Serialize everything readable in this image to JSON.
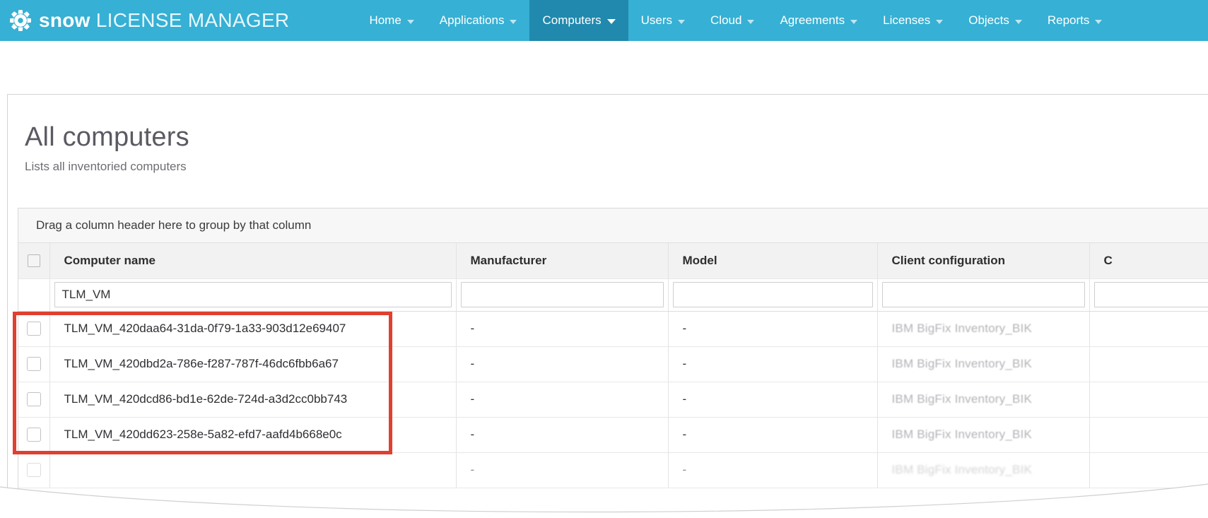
{
  "app": {
    "brand_primary": "snow",
    "brand_secondary": "LICENSE MANAGER",
    "brand_color": "#36b0d4",
    "brand_active_color": "#2089ad",
    "logo_icon": "gear-icon"
  },
  "nav": {
    "items": [
      {
        "label": "Home",
        "active": false,
        "has_caret": true
      },
      {
        "label": "Applications",
        "active": false,
        "has_caret": true
      },
      {
        "label": "Computers",
        "active": true,
        "has_caret": true
      },
      {
        "label": "Users",
        "active": false,
        "has_caret": true
      },
      {
        "label": "Cloud",
        "active": false,
        "has_caret": true
      },
      {
        "label": "Agreements",
        "active": false,
        "has_caret": true
      },
      {
        "label": "Licenses",
        "active": false,
        "has_caret": true
      },
      {
        "label": "Objects",
        "active": false,
        "has_caret": true
      },
      {
        "label": "Reports",
        "active": false,
        "has_caret": true
      }
    ]
  },
  "page": {
    "title": "All computers",
    "subtitle": "Lists all inventoried computers"
  },
  "grid": {
    "group_bar_text": "Drag a column header here to group by that column",
    "columns": [
      {
        "key": "checkbox",
        "label": ""
      },
      {
        "key": "name",
        "label": "Computer name"
      },
      {
        "key": "manufacturer",
        "label": "Manufacturer"
      },
      {
        "key": "model",
        "label": "Model"
      },
      {
        "key": "client_configuration",
        "label": "Client configuration"
      },
      {
        "key": "extra",
        "label": "C"
      }
    ],
    "filters": {
      "name": "TLM_VM",
      "name_placeholder": "",
      "manufacturer": "",
      "model": "",
      "client_configuration": "",
      "extra": ""
    },
    "rows": [
      {
        "name": "TLM_VM_420daa64-31da-0f79-1a33-903d12e69407",
        "manufacturer": "-",
        "model": "-",
        "client_configuration": "IBM BigFix Inventory_BIK",
        "extra": "",
        "faded": false
      },
      {
        "name": "TLM_VM_420dbd2a-786e-f287-787f-46dc6fbb6a67",
        "manufacturer": "-",
        "model": "-",
        "client_configuration": "IBM BigFix Inventory_BIK",
        "extra": "",
        "faded": false
      },
      {
        "name": "TLM_VM_420dcd86-bd1e-62de-724d-a3d2cc0bb743",
        "manufacturer": "-",
        "model": "-",
        "client_configuration": "IBM BigFix Inventory_BIK",
        "extra": "",
        "faded": false
      },
      {
        "name": "TLM_VM_420dd623-258e-5a82-efd7-aafd4b668e0c",
        "manufacturer": "-",
        "model": "-",
        "client_configuration": "IBM BigFix Inventory_BIK",
        "extra": "",
        "faded": false
      },
      {
        "name": "",
        "manufacturer": "-",
        "model": "-",
        "client_configuration": "IBM BigFix Inventory_BIK",
        "extra": "",
        "faded": true
      }
    ]
  },
  "annotation": {
    "highlight_color": "#e0402f",
    "type": "red-rectangle-highlight"
  }
}
